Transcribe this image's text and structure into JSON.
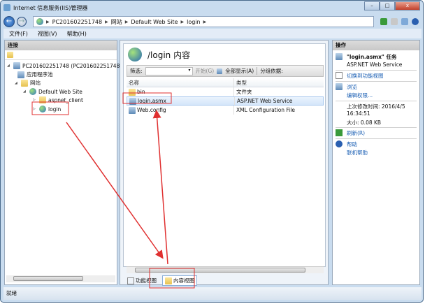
{
  "window": {
    "title": "Internet 信息服务(IIS)管理器",
    "min": "–",
    "max": "□",
    "close": "x"
  },
  "address": {
    "crumbs": [
      "PC201602251748",
      "网站",
      "Default Web Site",
      "login"
    ]
  },
  "menu": [
    "文件(F)",
    "视图(V)",
    "帮助(H)"
  ],
  "connections": {
    "title": "连接",
    "tree": [
      {
        "label": "PC201602251748 (PC201602251748\\"
      },
      {
        "label": "应用程序池"
      },
      {
        "label": "网站"
      },
      {
        "label": "Default Web Site"
      },
      {
        "label": "aspnet_client"
      },
      {
        "label": "login"
      }
    ]
  },
  "content": {
    "title": "/login 内容",
    "filter_label": "筛选:",
    "start": "开始(G)",
    "show_all": "全部显示(A)",
    "group_by": "分组依据:",
    "columns": [
      "名称",
      "类型"
    ],
    "rows": [
      {
        "name": "bin",
        "type": "文件夹"
      },
      {
        "name": "login.asmx",
        "type": "ASP.NET Web Service"
      },
      {
        "name": "Web.config",
        "type": "XML Configuration File"
      }
    ],
    "tabs": [
      "功能视图",
      "内容视图"
    ]
  },
  "actions": {
    "title": "操作",
    "task_title": "\"login.asmx\" 任务",
    "task_sub": "ASP.NET Web Service",
    "switch": "切换到功能视图",
    "browse": "浏览",
    "edit_perm": "编辑权限...",
    "modified_label": "上次修改时间: 2016/4/5",
    "modified_time": "16:34:51",
    "size": "大小: 0.08 KB",
    "refresh": "刷新(R)",
    "help": "帮助",
    "online_help": "联机帮助"
  },
  "status": "就绪",
  "colors": {
    "annotation": "#e03030",
    "link": "#1a5fb4"
  }
}
